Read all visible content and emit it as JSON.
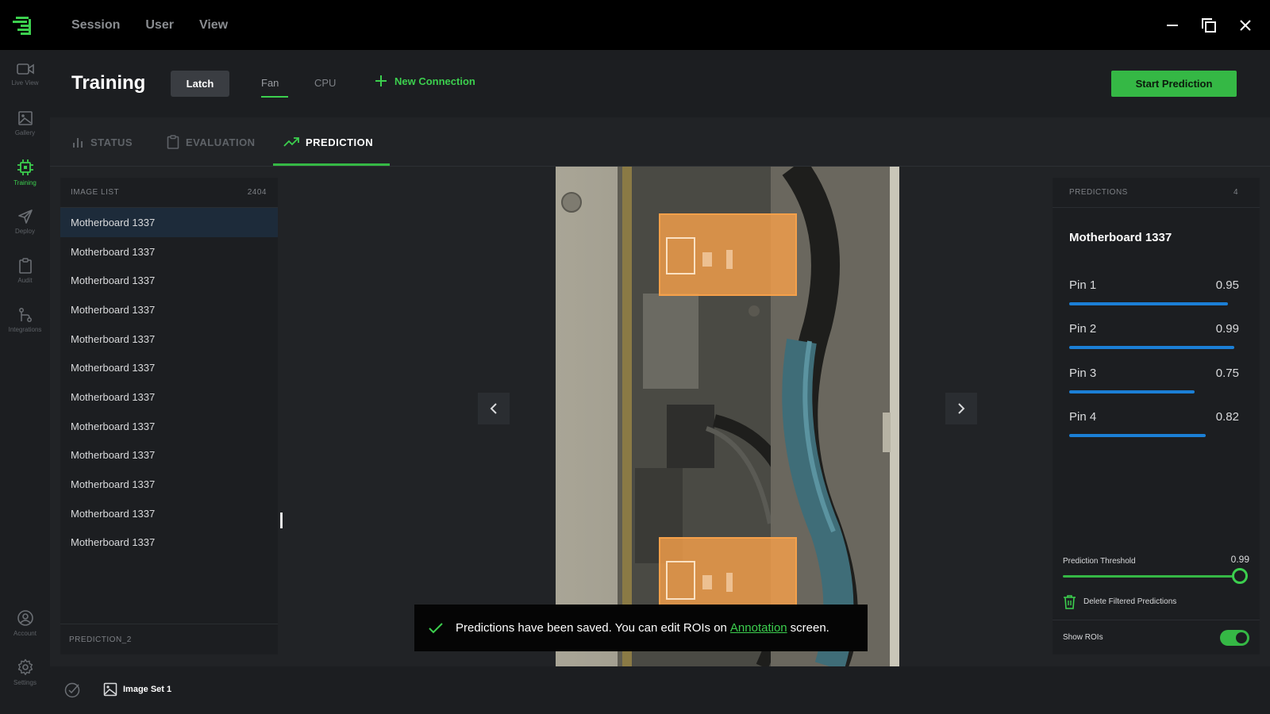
{
  "menu": [
    "Session",
    "User",
    "View"
  ],
  "rail": [
    {
      "label": "Live View",
      "icon": "video-camera-icon"
    },
    {
      "label": "Gallery",
      "icon": "image-icon"
    },
    {
      "label": "Training",
      "icon": "chip-icon",
      "active": true
    },
    {
      "label": "Deploy",
      "icon": "send-icon"
    },
    {
      "label": "Audit",
      "icon": "clipboard-icon"
    },
    {
      "label": "Integrations",
      "icon": "git-branch-icon"
    },
    {
      "label": "Account",
      "icon": "account-icon"
    },
    {
      "label": "Settings",
      "icon": "gear-icon"
    }
  ],
  "header": {
    "title": "Training",
    "chip": "Latch",
    "connections": [
      "Fan",
      "CPU"
    ],
    "new_connection": "New Connection",
    "start_button": "Start Prediction"
  },
  "subtabs": [
    "STATUS",
    "EVALUATION",
    "PREDICTION"
  ],
  "image_list": {
    "title": "IMAGE LIST",
    "count": "2404",
    "items": [
      "Motherboard 1337",
      "Motherboard 1337",
      "Motherboard 1337",
      "Motherboard 1337",
      "Motherboard 1337",
      "Motherboard 1337",
      "Motherboard 1337",
      "Motherboard 1337",
      "Motherboard 1337",
      "Motherboard 1337",
      "Motherboard 1337",
      "Motherboard 1337"
    ],
    "footer": "PREDICTION_2"
  },
  "predictions": {
    "title": "PREDICTIONS",
    "count": "4",
    "image_name": "Motherboard 1337",
    "pins": [
      {
        "label": "Pin 1",
        "score": "0.95",
        "value": 0.95
      },
      {
        "label": "Pin 2",
        "score": "0.99",
        "value": 0.99
      },
      {
        "label": "Pin 3",
        "score": "0.75",
        "value": 0.75
      },
      {
        "label": "Pin 4",
        "score": "0.82",
        "value": 0.82
      }
    ],
    "threshold_label": "Prediction Threshold",
    "threshold_value": "0.99",
    "delete_label": "Delete Filtered Predictions",
    "show_rois_label": "Show ROIs",
    "show_rois": true
  },
  "toast": {
    "before": "Predictions have been saved. You can edit ROIs on",
    "link": "Annotation",
    "after": "screen."
  },
  "bottom": {
    "image_set": "Image Set 1"
  },
  "colors": {
    "accent": "#3ccf4e",
    "bar": "#1b7fd6",
    "roi": "#f5a04a"
  }
}
